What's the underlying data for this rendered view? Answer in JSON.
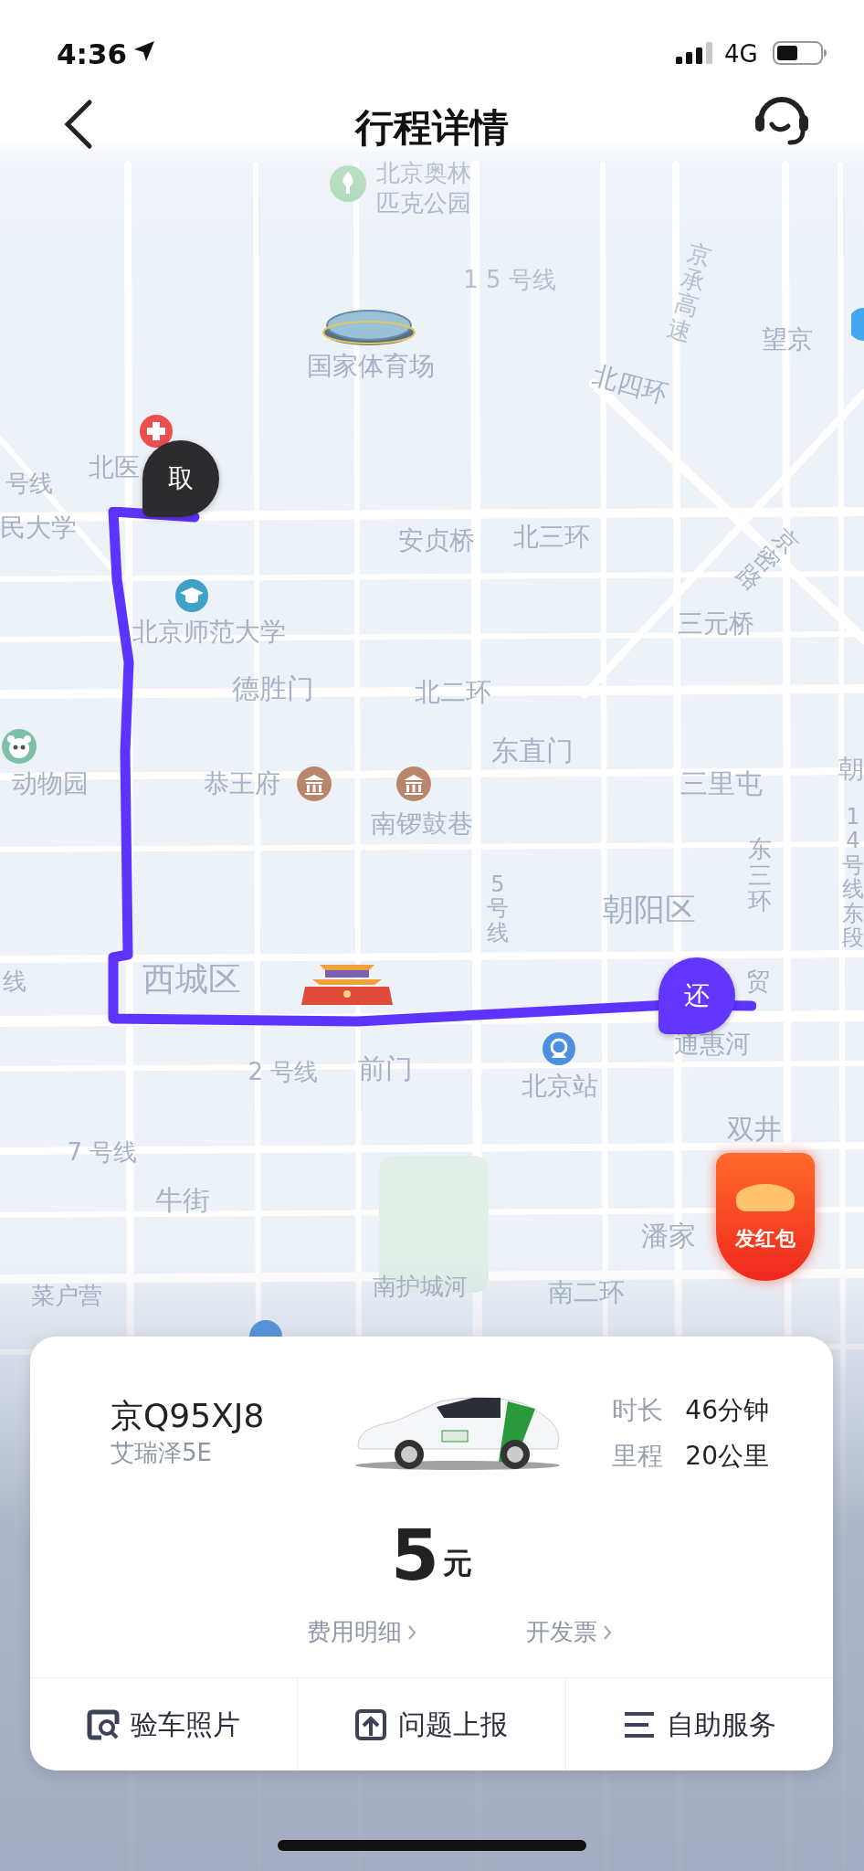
{
  "status_bar": {
    "time": "4:36",
    "network": "4G"
  },
  "header": {
    "title": "行程详情"
  },
  "map": {
    "labels": [
      {
        "text": "北京奥林"
      },
      {
        "text": "匹克公园"
      },
      {
        "text": "1 5 号线"
      },
      {
        "text": "京承高速"
      },
      {
        "text": "望京"
      },
      {
        "text": "国家体育场"
      },
      {
        "text": "北四环"
      },
      {
        "text": "北医"
      },
      {
        "text": "号线"
      },
      {
        "text": "民大学"
      },
      {
        "text": "安贞桥"
      },
      {
        "text": "北三环"
      },
      {
        "text": "京密路"
      },
      {
        "text": "北京师范大学"
      },
      {
        "text": "三元桥"
      },
      {
        "text": "德胜门"
      },
      {
        "text": "北二环"
      },
      {
        "text": "东直门"
      },
      {
        "text": "动物园"
      },
      {
        "text": "恭王府"
      },
      {
        "text": "南锣鼓巷"
      },
      {
        "text": "三里屯"
      },
      {
        "text": "朝"
      },
      {
        "text": "东三环"
      },
      {
        "text": "5号线"
      },
      {
        "text": "朝阳区"
      },
      {
        "text": "14号线东段"
      },
      {
        "text": "线"
      },
      {
        "text": "西城区"
      },
      {
        "text": "贸"
      },
      {
        "text": "通惠河"
      },
      {
        "text": "2 号线"
      },
      {
        "text": "前门"
      },
      {
        "text": "北京站"
      },
      {
        "text": "双井"
      },
      {
        "text": "7 号线"
      },
      {
        "text": "牛街"
      },
      {
        "text": "潘家"
      },
      {
        "text": "菜户营"
      },
      {
        "text": "南护城河"
      },
      {
        "text": "南二环"
      }
    ],
    "markers": [
      {
        "kind": "pickup",
        "text": "取"
      },
      {
        "kind": "return",
        "text": "还"
      }
    ],
    "red_packet": {
      "label": "发红包"
    }
  },
  "trip": {
    "plate": "京Q95XJ8",
    "model": "艾瑞泽5E",
    "stats": [
      {
        "label": "时长",
        "value": "46分钟"
      },
      {
        "label": "里程",
        "value": "20公里"
      }
    ],
    "price": "5",
    "currency": "元",
    "links": [
      {
        "label": "费用明细"
      },
      {
        "label": "开发票"
      }
    ],
    "actions": [
      {
        "kind": "photo",
        "label": "验车照片"
      },
      {
        "kind": "report",
        "label": "问题上报"
      },
      {
        "kind": "menu",
        "label": "自助服务"
      }
    ]
  }
}
